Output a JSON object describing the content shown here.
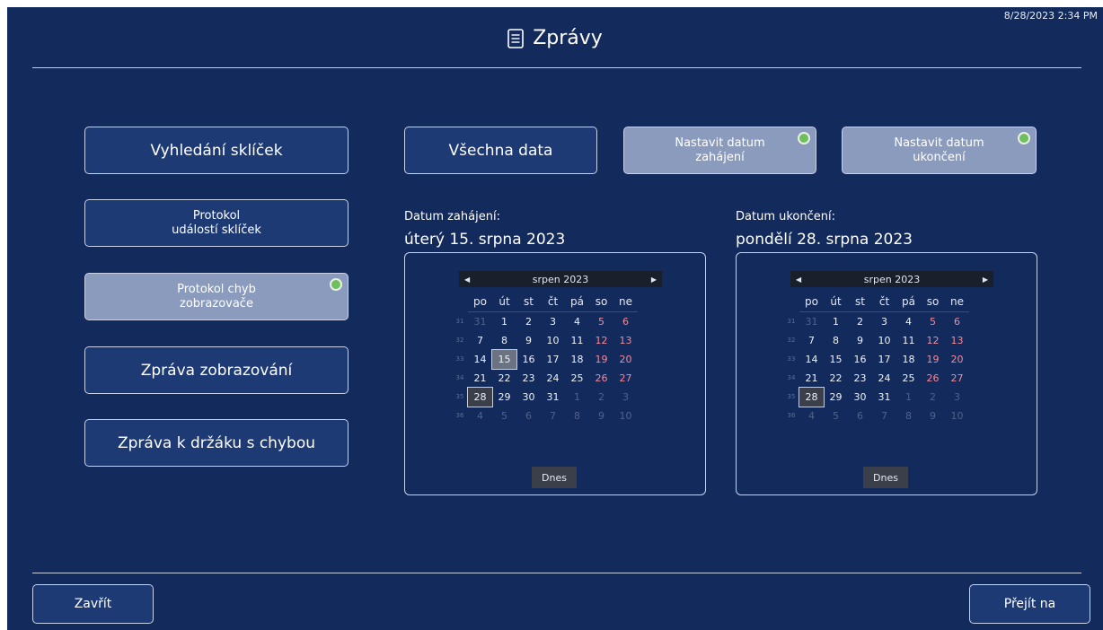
{
  "timestamp": "8/28/2023 2:34 PM",
  "title": "Zprávy",
  "left_buttons": [
    {
      "label": "Vyhledání sklíček"
    },
    {
      "label_lines": [
        "Protokol",
        "událostí sklíček"
      ]
    },
    {
      "label_lines": [
        "Protokol chyb",
        "zobrazovače"
      ]
    },
    {
      "label": "Zpráva zobrazování"
    },
    {
      "label": "Zpráva k držáku s chybou"
    }
  ],
  "top_buttons": {
    "all_data": "Všechna data",
    "set_start_lines": [
      "Nastavit datum",
      "zahájení"
    ],
    "set_end_lines": [
      "Nastavit datum",
      "ukončení"
    ]
  },
  "start": {
    "label": "Datum zahájení:",
    "value": "úterý 15. srpna 2023",
    "month": "srpen 2023",
    "selected_day": 15,
    "today": "Dnes"
  },
  "end": {
    "label": "Datum ukončení:",
    "value": "pondělí 28. srpna 2023",
    "month": "srpen 2023",
    "selected_day": 28,
    "today": "Dnes"
  },
  "weekday_headers": [
    "po",
    "út",
    "st",
    "čt",
    "pá",
    "so",
    "ne"
  ],
  "calendar_weeks": [
    {
      "week": "31",
      "days": [
        "31",
        "1",
        "2",
        "3",
        "4",
        "5",
        "6"
      ],
      "other_month": [
        0
      ]
    },
    {
      "week": "32",
      "days": [
        "7",
        "8",
        "9",
        "10",
        "11",
        "12",
        "13"
      ],
      "other_month": []
    },
    {
      "week": "33",
      "days": [
        "14",
        "15",
        "16",
        "17",
        "18",
        "19",
        "20"
      ],
      "other_month": []
    },
    {
      "week": "34",
      "days": [
        "21",
        "22",
        "23",
        "24",
        "25",
        "26",
        "27"
      ],
      "other_month": []
    },
    {
      "week": "35",
      "days": [
        "28",
        "29",
        "30",
        "31",
        "1",
        "2",
        "3"
      ],
      "other_month": [
        4,
        5,
        6
      ]
    },
    {
      "week": "36",
      "days": [
        "4",
        "5",
        "6",
        "7",
        "8",
        "9",
        "10"
      ],
      "other_month": [
        0,
        1,
        2,
        3,
        4,
        5,
        6
      ]
    }
  ],
  "highlighted_today": "28",
  "footer": {
    "close": "Zavřít",
    "goto": "Přejít na"
  },
  "colors": {
    "background": "#132a5c",
    "button": "#1d3a75",
    "button_disabled": "#8a9bbd",
    "weekend": "#f38a9a",
    "led": "#6fbf5f"
  }
}
